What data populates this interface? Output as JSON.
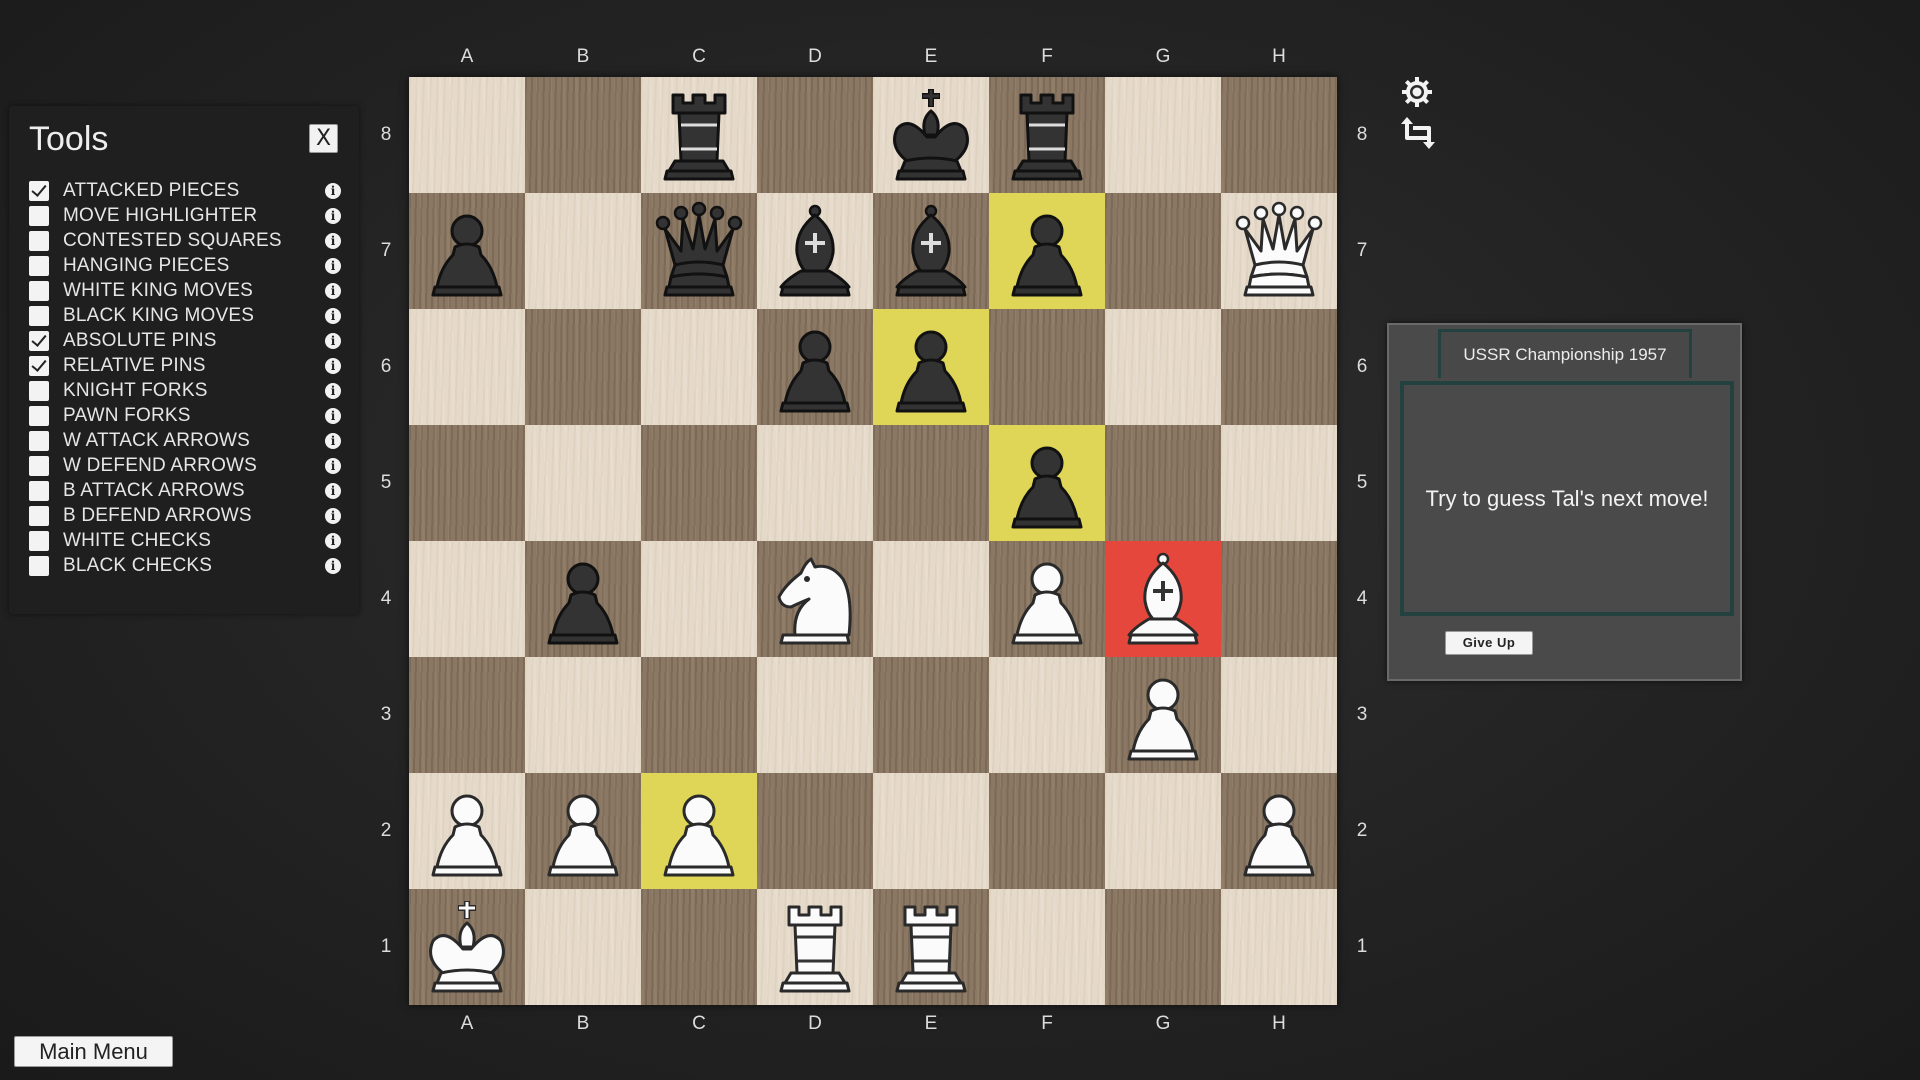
{
  "tools": {
    "title": "Tools",
    "close_label": "X",
    "items": [
      {
        "label": "ATTACKED PIECES",
        "checked": true
      },
      {
        "label": "MOVE HIGHLIGHTER",
        "checked": false
      },
      {
        "label": "CONTESTED SQUARES",
        "checked": false
      },
      {
        "label": "HANGING PIECES",
        "checked": false
      },
      {
        "label": "WHITE KING MOVES",
        "checked": false
      },
      {
        "label": "BLACK KING MOVES",
        "checked": false
      },
      {
        "label": "ABSOLUTE PINS",
        "checked": true
      },
      {
        "label": "RELATIVE PINS",
        "checked": true
      },
      {
        "label": "KNIGHT FORKS",
        "checked": false
      },
      {
        "label": "PAWN FORKS",
        "checked": false
      },
      {
        "label": "W ATTACK ARROWS",
        "checked": false
      },
      {
        "label": "W DEFEND ARROWS",
        "checked": false
      },
      {
        "label": "B ATTACK ARROWS",
        "checked": false
      },
      {
        "label": "B DEFEND ARROWS",
        "checked": false
      },
      {
        "label": "WHITE CHECKS",
        "checked": false
      },
      {
        "label": "BLACK CHECKS",
        "checked": false
      }
    ],
    "info_glyph": "i"
  },
  "board": {
    "files": [
      "A",
      "B",
      "C",
      "D",
      "E",
      "F",
      "G",
      "H"
    ],
    "ranks": [
      "8",
      "7",
      "6",
      "5",
      "4",
      "3",
      "2",
      "1"
    ],
    "pieces": {
      "c8": "bR",
      "e8": "bK",
      "f8": "bR",
      "a7": "bP",
      "c7": "bQ",
      "d7": "bB",
      "e7": "bB",
      "f7": "bP",
      "h7": "wQ",
      "d6": "bP",
      "e6": "bP",
      "f5": "bP",
      "b4": "bP",
      "d4": "wN",
      "f4": "wP",
      "g4": "wB",
      "g3": "wP",
      "a2": "wP",
      "b2": "wP",
      "c2": "wP",
      "h2": "wP",
      "a1": "wK",
      "d1": "wR",
      "e1": "wR"
    },
    "highlights": {
      "f7": "yellow",
      "e6": "yellow",
      "f5": "yellow",
      "c2": "yellow",
      "g4": "red"
    },
    "colors": {
      "light_square": "#e5d9c9",
      "dark_square": "#8a7864",
      "highlight_yellow": "#dfd657",
      "highlight_red": "#e5473d"
    }
  },
  "controls": {
    "settings_icon": "gear-icon",
    "flip_icon": "flip-board-icon"
  },
  "puzzle": {
    "tab_title": "USSR Championship 1957",
    "message": "Try to guess Tal's next move!",
    "give_up_label": "Give Up"
  },
  "footer": {
    "main_menu_label": "Main Menu"
  }
}
